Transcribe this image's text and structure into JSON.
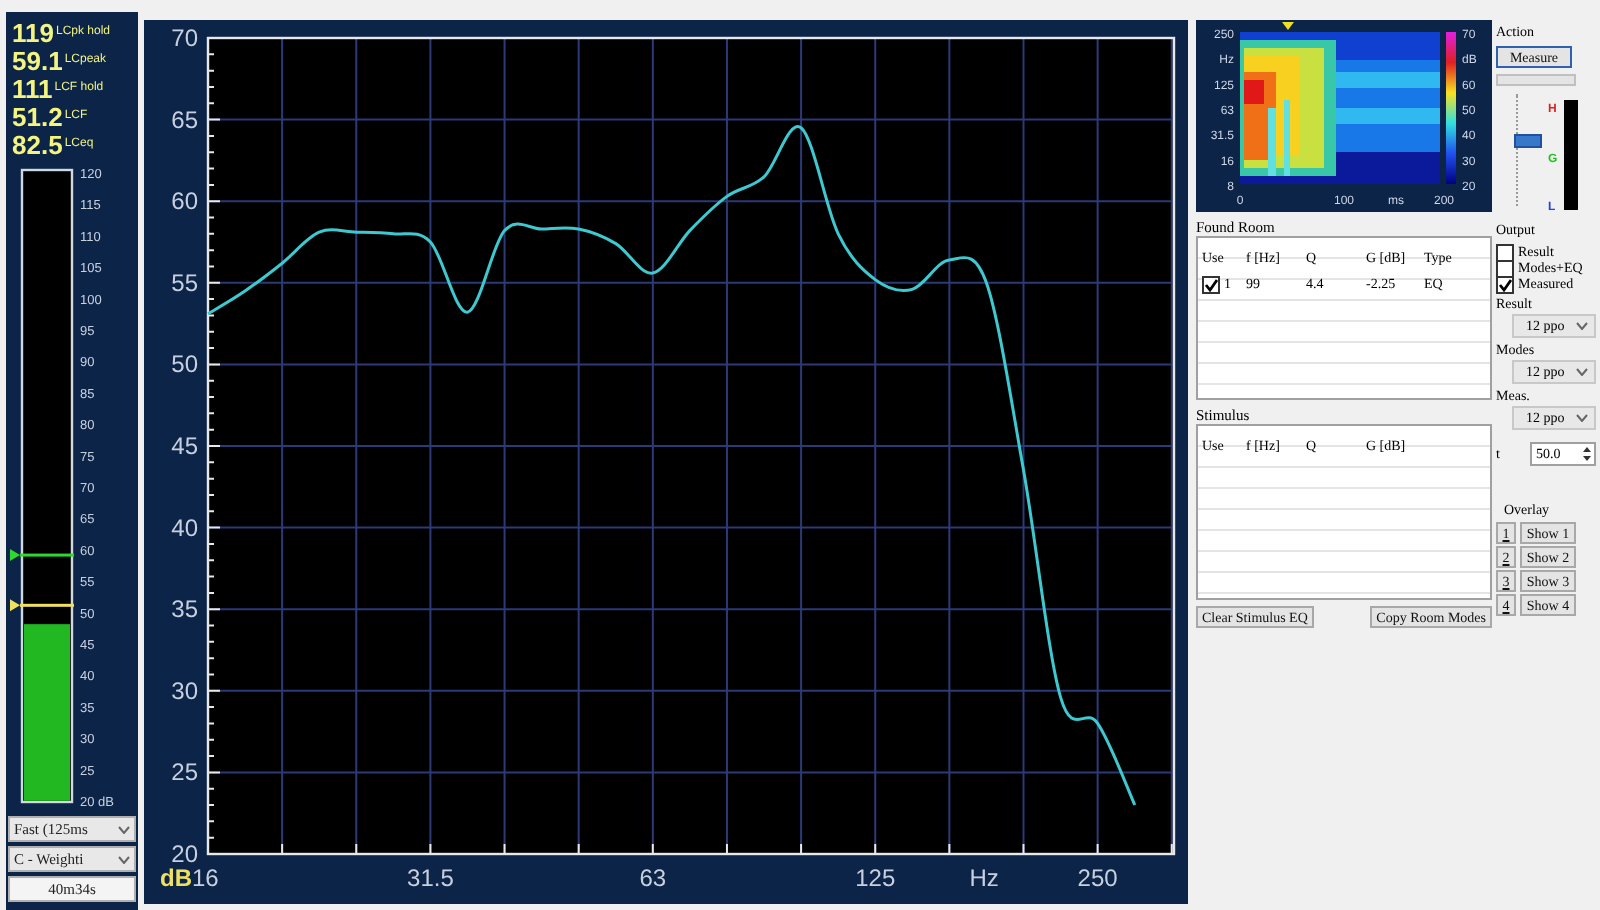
{
  "level_readout": [
    {
      "value": "119",
      "label": "LCpk hold"
    },
    {
      "value": "59.1",
      "label": "LCpeak"
    },
    {
      "value": "111",
      "label": "LCF hold"
    },
    {
      "value": "51.2",
      "label": "LCF"
    },
    {
      "value": "82.5",
      "label": "LCeq"
    }
  ],
  "meter": {
    "scale": [
      "120",
      "115",
      "110",
      "105",
      "100",
      "95",
      "90",
      "85",
      "80",
      "75",
      "70",
      "65",
      "60",
      "55",
      "50",
      "45",
      "40",
      "35",
      "30",
      "25",
      "20 dB"
    ],
    "level": 0.28,
    "markers": [
      {
        "level": 0.39,
        "color": "#2ed82e"
      },
      {
        "level": 0.31,
        "color": "#f0e060"
      }
    ]
  },
  "time_weighting": "Fast (125ms",
  "frequency_weighting": "C - Weighti",
  "elapsed": "40m34s",
  "chart": {
    "chart_data": {
      "type": "line",
      "xlabel": "Hz",
      "ylabel": "dB",
      "ylim": [
        20,
        70
      ],
      "grid": true,
      "categories": [
        "16",
        null,
        null,
        null,
        null,
        null,
        "31.5",
        null,
        null,
        null,
        null,
        null,
        "63",
        null,
        null,
        null,
        null,
        null,
        "125",
        null,
        null,
        null,
        null,
        null,
        "250",
        null,
        null
      ],
      "yticks": [
        20,
        25,
        30,
        35,
        40,
        45,
        50,
        55,
        60,
        65,
        70
      ],
      "series": [
        {
          "color": "#3ec8d0",
          "values": [
            53.1,
            54.5,
            56.2,
            58.1,
            58.1,
            58,
            57.5,
            53.2,
            58.2,
            58.3,
            58.3,
            57.4,
            55.6,
            58.2,
            60.3,
            61.5,
            64.5,
            58,
            55.2,
            54.6,
            56.4,
            55,
            43.5,
            29.6,
            28,
            23,
            null
          ]
        }
      ]
    }
  },
  "spectrogram": {
    "y_labels": [
      "250",
      "Hz",
      "125",
      "63",
      "31.5",
      "16",
      "8"
    ],
    "x_labels": [
      "0",
      "100",
      "ms",
      "200"
    ],
    "colorbar_labels": [
      "70",
      "dB",
      "60",
      "50",
      "40",
      "30",
      "20"
    ]
  },
  "action": {
    "title": "Action",
    "button": "Measure"
  },
  "output": {
    "title": "Output",
    "level": 0.6,
    "meter_labels": [
      "H",
      "G",
      "L"
    ]
  },
  "found_room": {
    "title": "Found Room",
    "columns": [
      "Use",
      "f [Hz]",
      "Q",
      "G [dB]",
      "Type"
    ],
    "rows": [
      {
        "use": true,
        "cells": [
          "1",
          "99",
          "4.4",
          "-2.25",
          "EQ"
        ]
      }
    ]
  },
  "checks": [
    {
      "label": "Result",
      "checked": false
    },
    {
      "label": "Modes+EQ",
      "checked": false
    },
    {
      "label": "Measured",
      "checked": true
    }
  ],
  "selects": [
    {
      "label": "Result",
      "value": "12 ppo"
    },
    {
      "label": "Modes",
      "value": "12 ppo"
    },
    {
      "label": "Meas.",
      "value": "12 ppo"
    }
  ],
  "t_field": {
    "label": "t",
    "value": "50.0"
  },
  "stimulus": {
    "title": "Stimulus",
    "columns": [
      "Use",
      "f [Hz]",
      "Q",
      "G [dB]"
    ]
  },
  "buttons": [
    "Clear Stimulus EQ",
    "Copy Room Modes"
  ],
  "overlay": {
    "title": "Overlay",
    "items": [
      {
        "key": "1",
        "label": "Show 1"
      },
      {
        "key": "2",
        "label": "Show 2"
      },
      {
        "key": "3",
        "label": "Show 3"
      },
      {
        "key": "4",
        "label": "Show 4"
      }
    ]
  }
}
